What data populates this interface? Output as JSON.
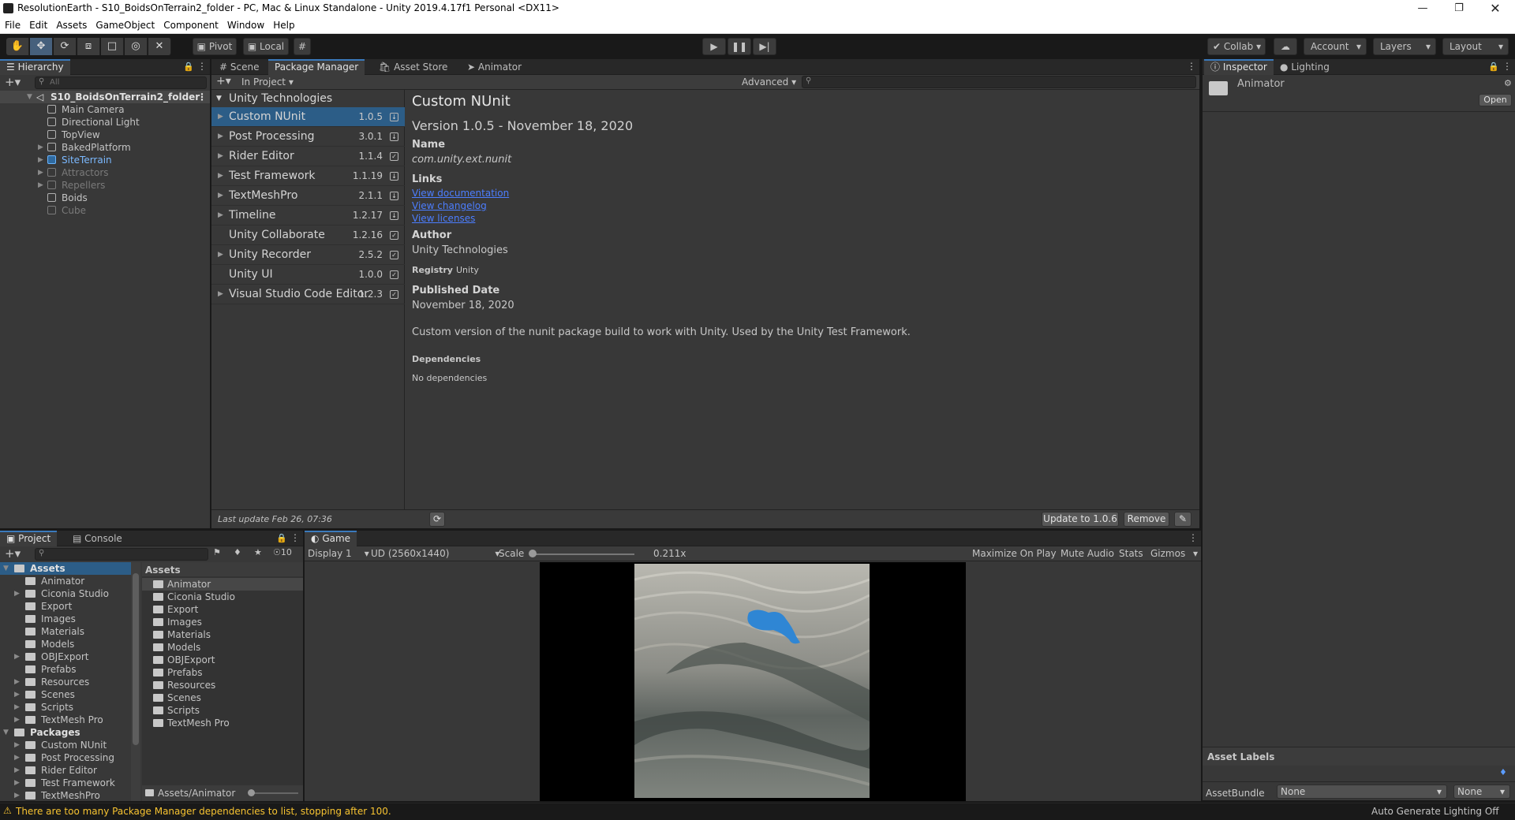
{
  "title": "ResolutionEarth - S10_BoidsOnTerrain2_folder - PC, Mac & Linux Standalone - Unity 2019.4.17f1 Personal <DX11>",
  "menu": [
    "File",
    "Edit",
    "Assets",
    "GameObject",
    "Component",
    "Window",
    "Help"
  ],
  "toolbar": {
    "pivot": "Pivot",
    "local": "Local",
    "collab": "Collab",
    "account": "Account",
    "layers": "Layers",
    "layout": "Layout"
  },
  "hierarchy": {
    "tab": "Hierarchy",
    "search_placeholder": "All",
    "scene": "S10_BoidsOnTerrain2_folder",
    "items": [
      {
        "label": "Main Camera",
        "state": "normal"
      },
      {
        "label": "Directional Light",
        "state": "normal"
      },
      {
        "label": "TopView",
        "state": "normal"
      },
      {
        "label": "BakedPlatform",
        "state": "normal"
      },
      {
        "label": "SiteTerrain",
        "state": "prefab"
      },
      {
        "label": "Attractors",
        "state": "disabled"
      },
      {
        "label": "Repellers",
        "state": "disabled"
      },
      {
        "label": "Boids",
        "state": "normal"
      },
      {
        "label": "Cube",
        "state": "disabled"
      }
    ]
  },
  "center_tabs": [
    "Scene",
    "Package Manager",
    "Asset Store",
    "Animator"
  ],
  "package_manager": {
    "filter": "In Project",
    "advanced": "Advanced",
    "group": "Unity Technologies",
    "packages": [
      {
        "name": "Custom NUnit",
        "version": "1.0.5",
        "selected": true
      },
      {
        "name": "Post Processing",
        "version": "3.0.1"
      },
      {
        "name": "Rider Editor",
        "version": "1.1.4"
      },
      {
        "name": "Test Framework",
        "version": "1.1.19"
      },
      {
        "name": "TextMeshPro",
        "version": "2.1.1"
      },
      {
        "name": "Timeline",
        "version": "1.2.17"
      },
      {
        "name": "Unity Collaborate",
        "version": "1.2.16"
      },
      {
        "name": "Unity Recorder",
        "version": "2.5.2"
      },
      {
        "name": "Unity UI",
        "version": "1.0.0"
      },
      {
        "name": "Visual Studio Code Editor",
        "version": "1.2.3"
      }
    ],
    "last_update": "Last update Feb 26, 07:36",
    "detail": {
      "title": "Custom NUnit",
      "version_line": "Version 1.0.5 - November 18, 2020",
      "name_label": "Name",
      "name_value": "com.unity.ext.nunit",
      "links_label": "Links",
      "link_doc": "View documentation",
      "link_changelog": "View changelog",
      "link_licenses": "View licenses",
      "author_label": "Author",
      "author_value": "Unity Technologies",
      "registry_label": "Registry",
      "registry_value": "Unity",
      "published_label": "Published Date",
      "published_value": "November 18,  2020",
      "description": "Custom version of the nunit package build to work with Unity. Used by the Unity Test Framework.",
      "deps_label": "Dependencies",
      "deps_value": "No dependencies",
      "update_btn": "Update to 1.0.6",
      "remove_btn": "Remove"
    }
  },
  "inspector": {
    "tab_inspector": "Inspector",
    "tab_lighting": "Lighting",
    "asset_name": "Animator",
    "open_btn": "Open",
    "asset_labels": "Asset Labels",
    "assetbundle_label": "AssetBundle",
    "assetbundle_value": "None",
    "variant_value": "None"
  },
  "project": {
    "tab_project": "Project",
    "tab_console": "Console",
    "hidden_count": "10",
    "tree": [
      {
        "label": "Assets",
        "level": 0,
        "bold": true,
        "selected": true
      },
      {
        "label": "Animator",
        "level": 1
      },
      {
        "label": "Ciconia Studio",
        "level": 1,
        "arrow": true
      },
      {
        "label": "Export",
        "level": 1
      },
      {
        "label": "Images",
        "level": 1
      },
      {
        "label": "Materials",
        "level": 1
      },
      {
        "label": "Models",
        "level": 1
      },
      {
        "label": "OBJExport",
        "level": 1,
        "arrow": true
      },
      {
        "label": "Prefabs",
        "level": 1
      },
      {
        "label": "Resources",
        "level": 1,
        "arrow": true
      },
      {
        "label": "Scenes",
        "level": 1,
        "arrow": true
      },
      {
        "label": "Scripts",
        "level": 1,
        "arrow": true
      },
      {
        "label": "TextMesh Pro",
        "level": 1,
        "arrow": true
      },
      {
        "label": "Packages",
        "level": 0,
        "bold": true
      },
      {
        "label": "Custom NUnit",
        "level": 1,
        "arrow": true
      },
      {
        "label": "Post Processing",
        "level": 1,
        "arrow": true
      },
      {
        "label": "Rider Editor",
        "level": 1,
        "arrow": true
      },
      {
        "label": "Test Framework",
        "level": 1,
        "arrow": true
      },
      {
        "label": "TextMeshPro",
        "level": 1,
        "arrow": true
      }
    ],
    "assets_header": "Assets",
    "assets": [
      "Animator",
      "Ciconia Studio",
      "Export",
      "Images",
      "Materials",
      "Models",
      "OBJExport",
      "Prefabs",
      "Resources",
      "Scenes",
      "Scripts",
      "TextMesh Pro"
    ],
    "path": "Assets/Animator"
  },
  "game": {
    "tab": "Game",
    "display": "Display 1",
    "resolution": "UD (2560x1440)",
    "scale_label": "Scale",
    "scale_value": "0.211x",
    "maximize": "Maximize On Play",
    "mute": "Mute Audio",
    "stats": "Stats",
    "gizmos": "Gizmos"
  },
  "status": {
    "warning": "There are too many Package Manager dependencies to list, stopping after 100.",
    "right": "Auto Generate Lighting Off"
  },
  "colors": {
    "accent": "#3a79bb",
    "selection": "#2c5d87",
    "link": "#4c7eff",
    "warning": "#f7c331"
  }
}
